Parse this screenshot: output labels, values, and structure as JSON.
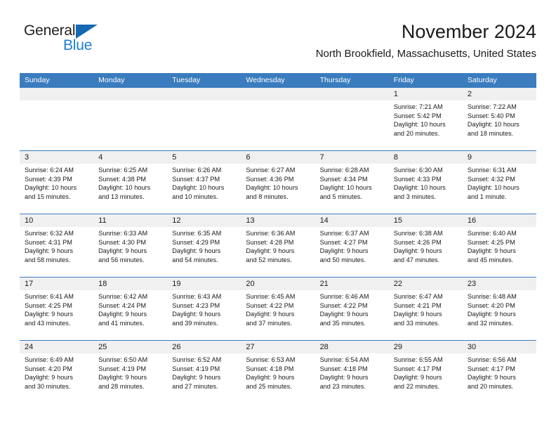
{
  "brand": {
    "name_part1": "General",
    "name_part2": "Blue",
    "triangle_color": "#1668b3",
    "blue_color": "#1b7fd4"
  },
  "header": {
    "title": "November 2024",
    "subtitle": "North Brookfield, Massachusetts, United States"
  },
  "theme": {
    "header_blue": "#3a7cbe",
    "day_number_bg": "#f0f0f0",
    "text": "#1a1a1a"
  },
  "weekdays": [
    "Sunday",
    "Monday",
    "Tuesday",
    "Wednesday",
    "Thursday",
    "Friday",
    "Saturday"
  ],
  "weeks": [
    [
      {
        "day": "",
        "sunrise": "",
        "sunset": "",
        "daylight_line1": "",
        "daylight_line2": ""
      },
      {
        "day": "",
        "sunrise": "",
        "sunset": "",
        "daylight_line1": "",
        "daylight_line2": ""
      },
      {
        "day": "",
        "sunrise": "",
        "sunset": "",
        "daylight_line1": "",
        "daylight_line2": ""
      },
      {
        "day": "",
        "sunrise": "",
        "sunset": "",
        "daylight_line1": "",
        "daylight_line2": ""
      },
      {
        "day": "",
        "sunrise": "",
        "sunset": "",
        "daylight_line1": "",
        "daylight_line2": ""
      },
      {
        "day": "1",
        "sunrise": "Sunrise: 7:21 AM",
        "sunset": "Sunset: 5:42 PM",
        "daylight_line1": "Daylight: 10 hours",
        "daylight_line2": "and 20 minutes."
      },
      {
        "day": "2",
        "sunrise": "Sunrise: 7:22 AM",
        "sunset": "Sunset: 5:40 PM",
        "daylight_line1": "Daylight: 10 hours",
        "daylight_line2": "and 18 minutes."
      }
    ],
    [
      {
        "day": "3",
        "sunrise": "Sunrise: 6:24 AM",
        "sunset": "Sunset: 4:39 PM",
        "daylight_line1": "Daylight: 10 hours",
        "daylight_line2": "and 15 minutes."
      },
      {
        "day": "4",
        "sunrise": "Sunrise: 6:25 AM",
        "sunset": "Sunset: 4:38 PM",
        "daylight_line1": "Daylight: 10 hours",
        "daylight_line2": "and 13 minutes."
      },
      {
        "day": "5",
        "sunrise": "Sunrise: 6:26 AM",
        "sunset": "Sunset: 4:37 PM",
        "daylight_line1": "Daylight: 10 hours",
        "daylight_line2": "and 10 minutes."
      },
      {
        "day": "6",
        "sunrise": "Sunrise: 6:27 AM",
        "sunset": "Sunset: 4:36 PM",
        "daylight_line1": "Daylight: 10 hours",
        "daylight_line2": "and 8 minutes."
      },
      {
        "day": "7",
        "sunrise": "Sunrise: 6:28 AM",
        "sunset": "Sunset: 4:34 PM",
        "daylight_line1": "Daylight: 10 hours",
        "daylight_line2": "and 5 minutes."
      },
      {
        "day": "8",
        "sunrise": "Sunrise: 6:30 AM",
        "sunset": "Sunset: 4:33 PM",
        "daylight_line1": "Daylight: 10 hours",
        "daylight_line2": "and 3 minutes."
      },
      {
        "day": "9",
        "sunrise": "Sunrise: 6:31 AM",
        "sunset": "Sunset: 4:32 PM",
        "daylight_line1": "Daylight: 10 hours",
        "daylight_line2": "and 1 minute."
      }
    ],
    [
      {
        "day": "10",
        "sunrise": "Sunrise: 6:32 AM",
        "sunset": "Sunset: 4:31 PM",
        "daylight_line1": "Daylight: 9 hours",
        "daylight_line2": "and 58 minutes."
      },
      {
        "day": "11",
        "sunrise": "Sunrise: 6:33 AM",
        "sunset": "Sunset: 4:30 PM",
        "daylight_line1": "Daylight: 9 hours",
        "daylight_line2": "and 56 minutes."
      },
      {
        "day": "12",
        "sunrise": "Sunrise: 6:35 AM",
        "sunset": "Sunset: 4:29 PM",
        "daylight_line1": "Daylight: 9 hours",
        "daylight_line2": "and 54 minutes."
      },
      {
        "day": "13",
        "sunrise": "Sunrise: 6:36 AM",
        "sunset": "Sunset: 4:28 PM",
        "daylight_line1": "Daylight: 9 hours",
        "daylight_line2": "and 52 minutes."
      },
      {
        "day": "14",
        "sunrise": "Sunrise: 6:37 AM",
        "sunset": "Sunset: 4:27 PM",
        "daylight_line1": "Daylight: 9 hours",
        "daylight_line2": "and 50 minutes."
      },
      {
        "day": "15",
        "sunrise": "Sunrise: 6:38 AM",
        "sunset": "Sunset: 4:26 PM",
        "daylight_line1": "Daylight: 9 hours",
        "daylight_line2": "and 47 minutes."
      },
      {
        "day": "16",
        "sunrise": "Sunrise: 6:40 AM",
        "sunset": "Sunset: 4:25 PM",
        "daylight_line1": "Daylight: 9 hours",
        "daylight_line2": "and 45 minutes."
      }
    ],
    [
      {
        "day": "17",
        "sunrise": "Sunrise: 6:41 AM",
        "sunset": "Sunset: 4:25 PM",
        "daylight_line1": "Daylight: 9 hours",
        "daylight_line2": "and 43 minutes."
      },
      {
        "day": "18",
        "sunrise": "Sunrise: 6:42 AM",
        "sunset": "Sunset: 4:24 PM",
        "daylight_line1": "Daylight: 9 hours",
        "daylight_line2": "and 41 minutes."
      },
      {
        "day": "19",
        "sunrise": "Sunrise: 6:43 AM",
        "sunset": "Sunset: 4:23 PM",
        "daylight_line1": "Daylight: 9 hours",
        "daylight_line2": "and 39 minutes."
      },
      {
        "day": "20",
        "sunrise": "Sunrise: 6:45 AM",
        "sunset": "Sunset: 4:22 PM",
        "daylight_line1": "Daylight: 9 hours",
        "daylight_line2": "and 37 minutes."
      },
      {
        "day": "21",
        "sunrise": "Sunrise: 6:46 AM",
        "sunset": "Sunset: 4:22 PM",
        "daylight_line1": "Daylight: 9 hours",
        "daylight_line2": "and 35 minutes."
      },
      {
        "day": "22",
        "sunrise": "Sunrise: 6:47 AM",
        "sunset": "Sunset: 4:21 PM",
        "daylight_line1": "Daylight: 9 hours",
        "daylight_line2": "and 33 minutes."
      },
      {
        "day": "23",
        "sunrise": "Sunrise: 6:48 AM",
        "sunset": "Sunset: 4:20 PM",
        "daylight_line1": "Daylight: 9 hours",
        "daylight_line2": "and 32 minutes."
      }
    ],
    [
      {
        "day": "24",
        "sunrise": "Sunrise: 6:49 AM",
        "sunset": "Sunset: 4:20 PM",
        "daylight_line1": "Daylight: 9 hours",
        "daylight_line2": "and 30 minutes."
      },
      {
        "day": "25",
        "sunrise": "Sunrise: 6:50 AM",
        "sunset": "Sunset: 4:19 PM",
        "daylight_line1": "Daylight: 9 hours",
        "daylight_line2": "and 28 minutes."
      },
      {
        "day": "26",
        "sunrise": "Sunrise: 6:52 AM",
        "sunset": "Sunset: 4:19 PM",
        "daylight_line1": "Daylight: 9 hours",
        "daylight_line2": "and 27 minutes."
      },
      {
        "day": "27",
        "sunrise": "Sunrise: 6:53 AM",
        "sunset": "Sunset: 4:18 PM",
        "daylight_line1": "Daylight: 9 hours",
        "daylight_line2": "and 25 minutes."
      },
      {
        "day": "28",
        "sunrise": "Sunrise: 6:54 AM",
        "sunset": "Sunset: 4:18 PM",
        "daylight_line1": "Daylight: 9 hours",
        "daylight_line2": "and 23 minutes."
      },
      {
        "day": "29",
        "sunrise": "Sunrise: 6:55 AM",
        "sunset": "Sunset: 4:17 PM",
        "daylight_line1": "Daylight: 9 hours",
        "daylight_line2": "and 22 minutes."
      },
      {
        "day": "30",
        "sunrise": "Sunrise: 6:56 AM",
        "sunset": "Sunset: 4:17 PM",
        "daylight_line1": "Daylight: 9 hours",
        "daylight_line2": "and 20 minutes."
      }
    ]
  ]
}
